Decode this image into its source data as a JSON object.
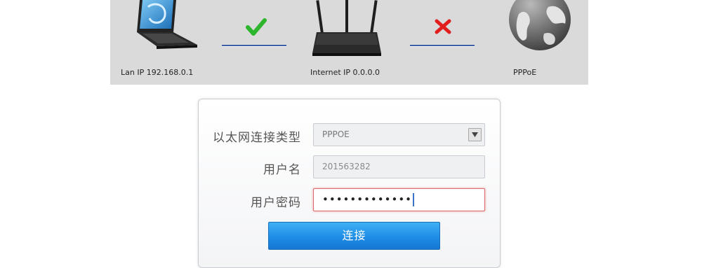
{
  "status_banner": {
    "lan_label": "Lan IP 192.168.0.1",
    "internet_label": "Internet IP 0.0.0.0",
    "wan_label": "PPPoE",
    "lan_link_status": "connected",
    "wan_link_status": "disconnected",
    "colors": {
      "banner_bg": "#dadada",
      "link_line": "#3d5fa8",
      "ok_mark": "#2db52d",
      "fail_mark": "#e11d1d"
    }
  },
  "form": {
    "connection_type": {
      "label": "以太网连接类型",
      "value": "PPPOE"
    },
    "username": {
      "label": "用户名",
      "value": "201563282"
    },
    "password": {
      "label": "用户密码",
      "value": "•••••••••••••"
    },
    "connect_button": {
      "label": "连接"
    },
    "colors": {
      "button": "#1e8de6",
      "error_border": "#e06a6a"
    }
  }
}
